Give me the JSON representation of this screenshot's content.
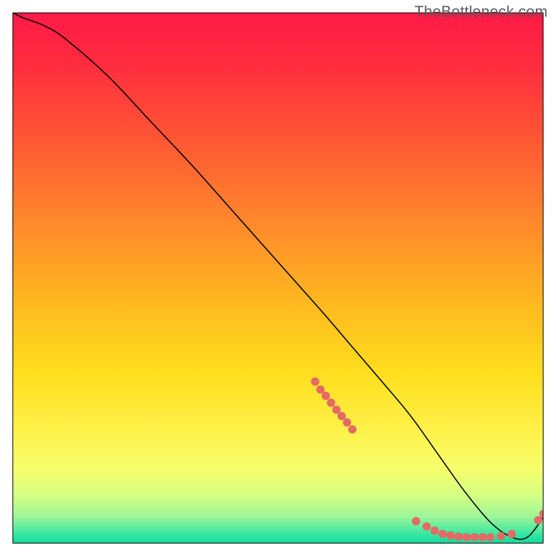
{
  "watermark": "TheBottleneck.com",
  "chart_data": {
    "type": "line",
    "title": "",
    "xlabel": "",
    "ylabel": "",
    "xlim": [
      0,
      100
    ],
    "ylim": [
      0,
      100
    ],
    "grid": false,
    "legend": false,
    "gradient_stops": [
      {
        "offset": 0.0,
        "color": "#ff1a46"
      },
      {
        "offset": 0.1,
        "color": "#ff2d3f"
      },
      {
        "offset": 0.25,
        "color": "#ff5a33"
      },
      {
        "offset": 0.4,
        "color": "#ff8a2b"
      },
      {
        "offset": 0.55,
        "color": "#ffb91f"
      },
      {
        "offset": 0.68,
        "color": "#ffde1e"
      },
      {
        "offset": 0.78,
        "color": "#fff047"
      },
      {
        "offset": 0.86,
        "color": "#f6ff6c"
      },
      {
        "offset": 0.91,
        "color": "#d4ff82"
      },
      {
        "offset": 0.95,
        "color": "#9cf59a"
      },
      {
        "offset": 0.985,
        "color": "#2fe6a2"
      },
      {
        "offset": 1.0,
        "color": "#12d99b"
      }
    ],
    "series": [
      {
        "name": "bottleneck-curve",
        "color": "#000000",
        "x": [
          0,
          2,
          6,
          10,
          18,
          26,
          34,
          42,
          50,
          58,
          64,
          70,
          75,
          80,
          85,
          90,
          94,
          97,
          100
        ],
        "y": [
          100,
          99,
          97.5,
          95,
          88,
          79.5,
          71,
          62,
          53,
          44,
          37,
          30,
          24,
          17,
          10,
          4,
          1.2,
          1.2,
          5
        ]
      }
    ],
    "markers": [
      {
        "name": "cluster-upper",
        "color": "#e46a66",
        "r": 6,
        "points": [
          {
            "x": 57,
            "y": 30.5
          },
          {
            "x": 58,
            "y": 29
          },
          {
            "x": 59,
            "y": 27.8
          },
          {
            "x": 60,
            "y": 26.5
          },
          {
            "x": 61,
            "y": 25.2
          },
          {
            "x": 62,
            "y": 24
          },
          {
            "x": 63,
            "y": 22.8
          },
          {
            "x": 64,
            "y": 21.5
          }
        ]
      },
      {
        "name": "cluster-bottom",
        "color": "#e46a66",
        "r": 6,
        "points": [
          {
            "x": 76,
            "y": 4.2
          },
          {
            "x": 78,
            "y": 3.2
          },
          {
            "x": 79.5,
            "y": 2.4
          },
          {
            "x": 81,
            "y": 1.8
          },
          {
            "x": 82.5,
            "y": 1.5
          },
          {
            "x": 84,
            "y": 1.3
          },
          {
            "x": 85.5,
            "y": 1.2
          },
          {
            "x": 87,
            "y": 1.2
          },
          {
            "x": 88.5,
            "y": 1.2
          },
          {
            "x": 90,
            "y": 1.2
          },
          {
            "x": 92,
            "y": 1.4
          },
          {
            "x": 94,
            "y": 1.8
          }
        ]
      },
      {
        "name": "cluster-right",
        "color": "#e46a66",
        "r": 6,
        "points": [
          {
            "x": 99,
            "y": 4.4
          },
          {
            "x": 100,
            "y": 5.6
          }
        ]
      }
    ]
  }
}
